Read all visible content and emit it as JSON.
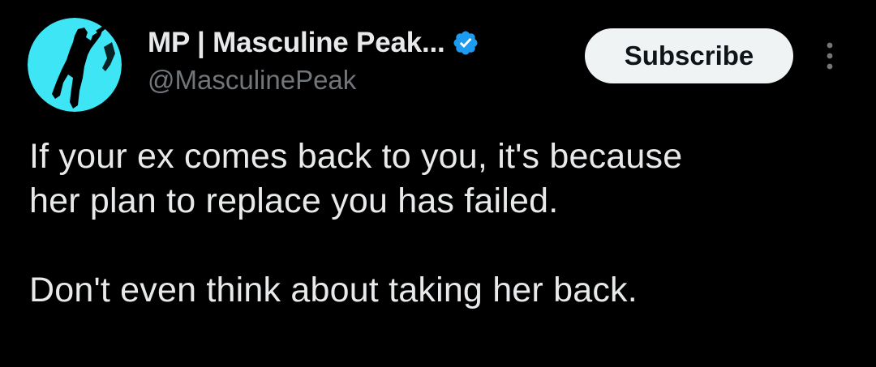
{
  "author": {
    "display_name": "MP | Masculine Peak...",
    "handle": "@MasculinePeak",
    "avatar_icon": "climber-silhouette-icon",
    "verified_icon": "verified-badge-icon",
    "verified_color": "#1d9bf0",
    "avatar_color": "#3ee6f5"
  },
  "actions": {
    "subscribe_label": "Subscribe",
    "more_icon": "more-vertical-icon"
  },
  "tweet": {
    "line_1": "If your ex comes back to you, it's because",
    "line_2": "her plan to replace you has failed.",
    "line_3": "Don't even think about taking her back."
  },
  "colors": {
    "background": "#000000",
    "text_primary": "#e7e9ea",
    "text_secondary": "#71767b",
    "button_bg": "#eff3f4"
  }
}
